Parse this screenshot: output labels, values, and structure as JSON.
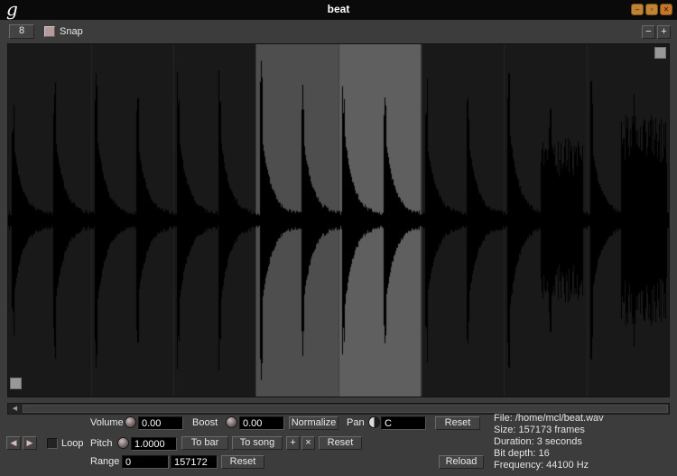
{
  "window": {
    "title": "beat",
    "logo": "g"
  },
  "titlebar": {
    "minimize": "–",
    "maximize": "▫",
    "close": "✕"
  },
  "toolbar": {
    "grid_size": "8",
    "snap_label": "Snap",
    "zoom_out": "−",
    "zoom_in": "+"
  },
  "scrollbar": {
    "left_arrow": "◀"
  },
  "transport": {
    "prev": "◀",
    "next": "▶",
    "loop_label": "Loop"
  },
  "controls": {
    "volume_label": "Volume",
    "volume_value": "0.00",
    "boost_label": "Boost",
    "boost_value": "0.00",
    "normalize_label": "Normalize",
    "pan_label": "Pan",
    "pan_value": "C",
    "pan_reset_label": "Reset",
    "pitch_label": "Pitch",
    "pitch_value": "1.0000",
    "to_bar_label": "To bar",
    "to_song_label": "To song",
    "pitch_add_label": "+",
    "pitch_mul_label": "×",
    "pitch_reset_label": "Reset",
    "range_label": "Range",
    "range_start": "0",
    "range_end": "157172",
    "range_reset_label": "Reset",
    "reload_label": "Reload"
  },
  "info": {
    "file": "File: /home/mcl/beat.wav",
    "size": "Size: 157173 frames",
    "duration": "Duration: 3 seconds",
    "bit_depth": "Bit depth: 16",
    "frequency": "Frequency: 44100 Hz"
  },
  "waveform": {
    "bars": 8,
    "hits_per_bar": 2,
    "selection_start_bar": 3,
    "selection_end_bar": 5,
    "colors": {
      "background": "#191919",
      "wave": "#000000",
      "selection_a": "#4e4e4e",
      "selection_b": "#5f5f5f"
    },
    "dense_regions": [
      {
        "start": 590,
        "end": 636,
        "base": 48,
        "var": 45
      },
      {
        "start": 679,
        "end": 729,
        "base": 62,
        "var": 55
      }
    ]
  }
}
